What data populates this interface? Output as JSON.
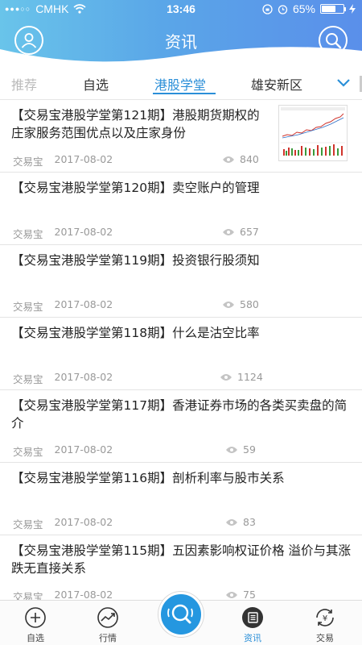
{
  "status": {
    "carrier": "CMHK",
    "time": "13:46",
    "battery": "65%",
    "battery_level": 0.65
  },
  "header": {
    "title": "资讯"
  },
  "tabs": [
    {
      "label": "推荐"
    },
    {
      "label": "自选"
    },
    {
      "label": "港股学堂"
    },
    {
      "label": "雄安新区"
    }
  ],
  "news": [
    {
      "title": "【交易宝港股学堂第121期】港股期货期权的庄家服务范围优点以及庄家身份",
      "source": "交易宝",
      "date": "2017-08-02",
      "views": "840"
    },
    {
      "title": "【交易宝港股学堂第120期】卖空账户的管理",
      "source": "交易宝",
      "date": "2017-08-02",
      "views": "657"
    },
    {
      "title": "【交易宝港股学堂第119期】投资银行股须知",
      "source": "交易宝",
      "date": "2017-08-02",
      "views": "580"
    },
    {
      "title": "【交易宝港股学堂第118期】什么是沽空比率",
      "source": "交易宝",
      "date": "2017-08-02",
      "views": "1124"
    },
    {
      "title": "【交易宝港股学堂第117期】香港证券市场的各类买卖盘的简介",
      "source": "交易宝",
      "date": "2017-08-02",
      "views": "59"
    },
    {
      "title": "【交易宝港股学堂第116期】剖析利率与股市关系",
      "source": "交易宝",
      "date": "2017-08-02",
      "views": "83"
    },
    {
      "title": "【交易宝港股学堂第115期】五因素影响权证价格 溢价与其涨跌无直接关系",
      "source": "交易宝",
      "date": "2017-08-02",
      "views": "75"
    }
  ],
  "bottom_nav": [
    {
      "label": "自选",
      "icon": "plus-circle-icon"
    },
    {
      "label": "行情",
      "icon": "trend-icon"
    },
    {
      "label": "资讯",
      "icon": "news-icon"
    },
    {
      "label": "交易",
      "icon": "yuan-exchange-icon"
    }
  ],
  "colors": {
    "accent": "#2b8fd8",
    "header_start": "#69c4ea",
    "header_end": "#5a8fea"
  }
}
